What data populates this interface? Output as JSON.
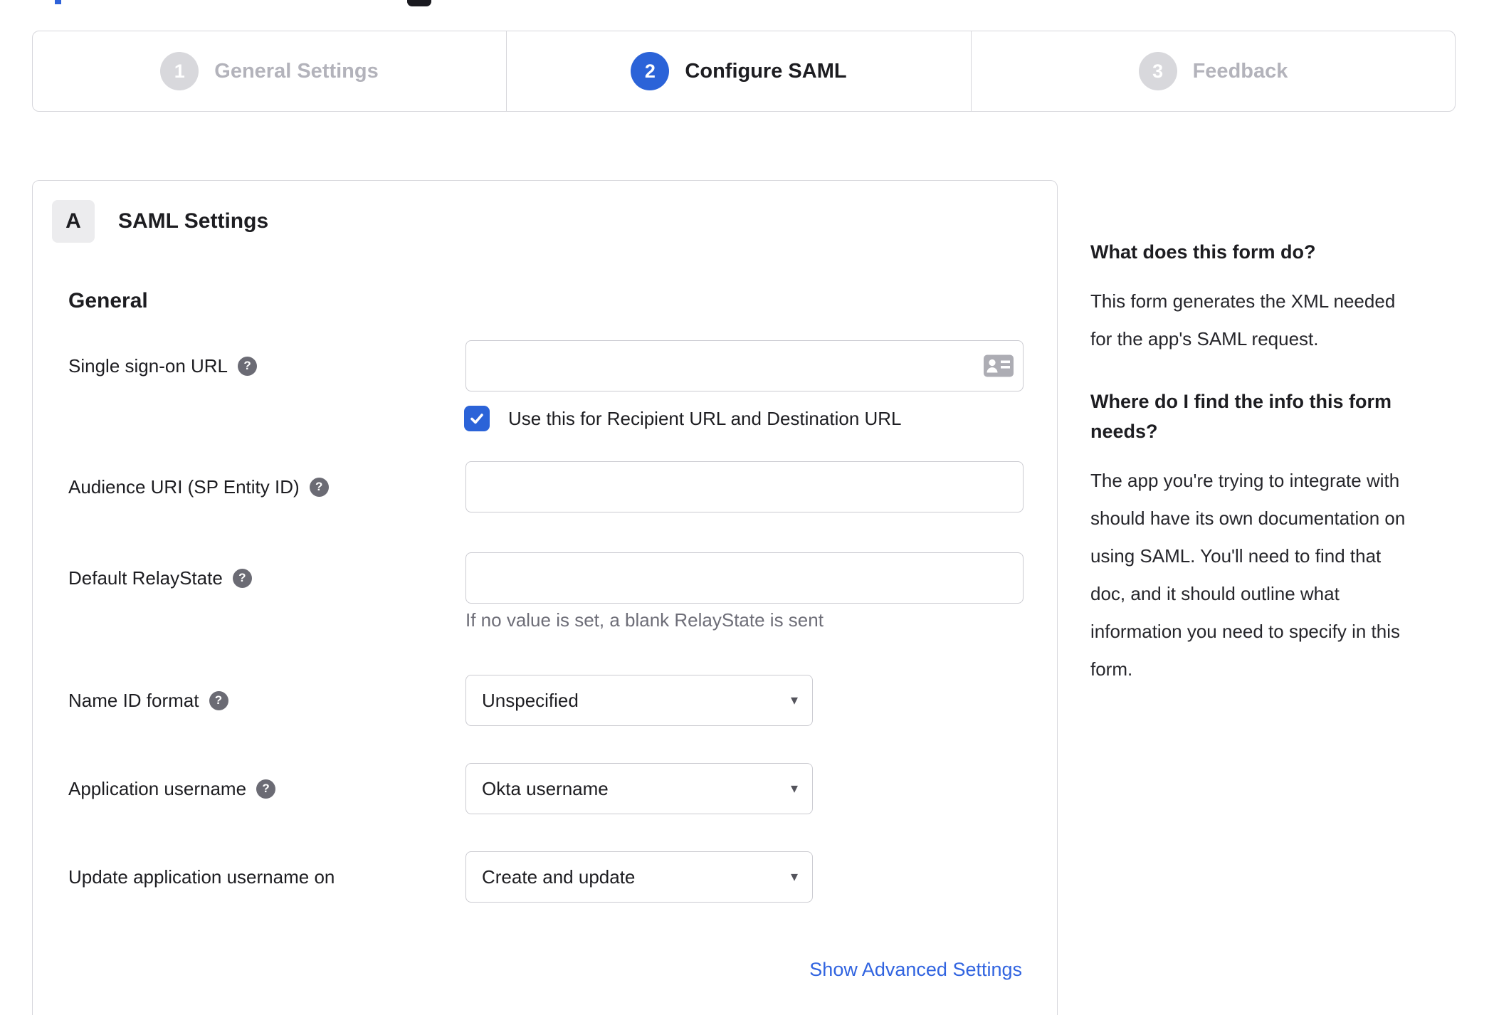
{
  "page": {
    "background": "#ffffff"
  },
  "top_fragments": {
    "blue_color": "#2e62d9",
    "dark_color": "#1a1a20"
  },
  "stepper": {
    "steps": [
      {
        "number": "1",
        "label": "General Settings",
        "state": "inactive"
      },
      {
        "number": "2",
        "label": "Configure SAML",
        "state": "active"
      },
      {
        "number": "3",
        "label": "Feedback",
        "state": "inactive"
      }
    ]
  },
  "form": {
    "section_badge": "A",
    "section_title": "SAML Settings",
    "group_title": "General",
    "sso": {
      "label": "Single sign-on URL",
      "value": "",
      "checkbox_label": "Use this for Recipient URL and Destination URL",
      "checkbox_checked": true
    },
    "audience": {
      "label": "Audience URI (SP Entity ID)",
      "value": ""
    },
    "relay": {
      "label": "Default RelayState",
      "value": "",
      "helper": "If no value is set, a blank RelayState is sent"
    },
    "name_id": {
      "label": "Name ID format",
      "value": "Unspecified"
    },
    "app_username": {
      "label": "Application username",
      "value": "Okta username"
    },
    "update_username": {
      "label": "Update application username on",
      "value": "Create and update"
    },
    "advanced_link": "Show Advanced Settings"
  },
  "help": {
    "q1": "What does this form do?",
    "a1_lines": [
      "This form generates the XML needed",
      "for the app's SAML request."
    ],
    "q2_lines": [
      "Where do I find the info this form",
      "needs?"
    ],
    "a2_lines": [
      "The app you're trying to integrate with",
      "should have its own documentation on",
      "using SAML. You'll need to find that",
      "doc, and it should outline what",
      "information you need to specify in this",
      "form."
    ]
  },
  "icons": {
    "help": "?",
    "caret": "▾",
    "check": "check-icon",
    "sso_input_icon": "contact-card"
  },
  "colors": {
    "accent_blue": "#2b63d8",
    "link_blue": "#3164e0",
    "container_border": "#d7d7dc",
    "field_border": "#cbcbd1",
    "inactive_gray": "#b3b3bb",
    "circle_gray": "#d8d8dc",
    "text_dark": "#1d1d21",
    "muted_gray": "#6e6e78",
    "badge_bg": "#ececee"
  }
}
